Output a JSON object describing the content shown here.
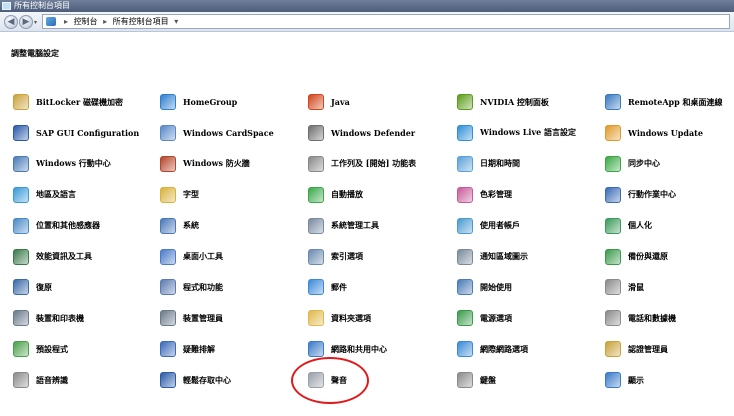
{
  "window": {
    "title": "所有控制台項目"
  },
  "nav": {
    "back_glyph": "◀",
    "forward_glyph": "▶",
    "dropdown_glyph": "▾",
    "breadcrumb": [
      "控制台",
      "所有控制台項目"
    ],
    "separator": "▸",
    "trailing_dropdown": "▾"
  },
  "main": {
    "heading": "調整電腦設定"
  },
  "items": [
    {
      "label": "BitLocker 磁碟機加密",
      "icon": "bitlocker-icon",
      "color": "#c9a23a"
    },
    {
      "label": "HomeGroup",
      "icon": "homegroup-icon",
      "color": "#2f7fd0"
    },
    {
      "label": "Java",
      "icon": "java-icon",
      "color": "#d1451b"
    },
    {
      "label": "NVIDIA 控制面板",
      "icon": "nvidia-icon",
      "color": "#5c9d1c"
    },
    {
      "label": "RemoteApp 和桌面連線",
      "icon": "remoteapp-icon",
      "color": "#3a78c2"
    },
    {
      "label": "SAP GUI Configuration",
      "icon": "sap-icon",
      "color": "#2a5aa8"
    },
    {
      "label": "Windows CardSpace",
      "icon": "cardspace-icon",
      "color": "#5a88c8"
    },
    {
      "label": "Windows Defender",
      "icon": "defender-icon",
      "color": "#6e6e6e"
    },
    {
      "label": "Windows Live 語言設定",
      "icon": "windows-live-icon",
      "color": "#2f8fd8"
    },
    {
      "label": "Windows Update",
      "icon": "windows-update-icon",
      "color": "#e09a2a"
    },
    {
      "label": "Windows 行動中心",
      "icon": "mobility-center-icon",
      "color": "#4a7ab8"
    },
    {
      "label": "Windows 防火牆",
      "icon": "firewall-icon",
      "color": "#b5452a"
    },
    {
      "label": "工作列及 [開始] 功能表",
      "icon": "taskbar-icon",
      "color": "#888888"
    },
    {
      "label": "日期和時間",
      "icon": "date-time-icon",
      "color": "#5aa0d8"
    },
    {
      "label": "同步中心",
      "icon": "sync-center-icon",
      "color": "#3aa844"
    },
    {
      "label": "地區及語言",
      "icon": "region-language-icon",
      "color": "#3a9ad8"
    },
    {
      "label": "字型",
      "icon": "fonts-icon",
      "color": "#d8b23a"
    },
    {
      "label": "自動播放",
      "icon": "autoplay-icon",
      "color": "#3aa84a"
    },
    {
      "label": "色彩管理",
      "icon": "color-management-icon",
      "color": "#c85a9a"
    },
    {
      "label": "行動作業中心",
      "icon": "action-center-icon",
      "color": "#3a6ab8"
    },
    {
      "label": "位置和其他感應器",
      "icon": "location-sensors-icon",
      "color": "#4a8ac8"
    },
    {
      "label": "系統",
      "icon": "system-icon",
      "color": "#4a78b8"
    },
    {
      "label": "系統管理工具",
      "icon": "admin-tools-icon",
      "color": "#7a8aa0"
    },
    {
      "label": "使用者帳戶",
      "icon": "user-accounts-icon",
      "color": "#4a9ad0"
    },
    {
      "label": "個人化",
      "icon": "personalization-icon",
      "color": "#3a9a5a"
    },
    {
      "label": "效能資訊及工具",
      "icon": "performance-icon",
      "color": "#3a7a4a"
    },
    {
      "label": "桌面小工具",
      "icon": "gadgets-icon",
      "color": "#4a7ac8"
    },
    {
      "label": "索引選項",
      "icon": "indexing-icon",
      "color": "#6a8ab0"
    },
    {
      "label": "通知區域圖示",
      "icon": "notification-area-icon",
      "color": "#7a8a9a"
    },
    {
      "label": "備份與還原",
      "icon": "backup-restore-icon",
      "color": "#3a9a4a"
    },
    {
      "label": "復原",
      "icon": "recovery-icon",
      "color": "#3a6aa8"
    },
    {
      "label": "程式和功能",
      "icon": "programs-features-icon",
      "color": "#5a7ab0"
    },
    {
      "label": "郵件",
      "icon": "mail-icon",
      "color": "#3a8ad8"
    },
    {
      "label": "開始使用",
      "icon": "getting-started-icon",
      "color": "#4a7ab8"
    },
    {
      "label": "滑鼠",
      "icon": "mouse-icon",
      "color": "#8a8a8a"
    },
    {
      "label": "裝置和印表機",
      "icon": "devices-printers-icon",
      "color": "#6a7a8a"
    },
    {
      "label": "裝置管理員",
      "icon": "device-manager-icon",
      "color": "#6a7a8a"
    },
    {
      "label": "資料夾選項",
      "icon": "folder-options-icon",
      "color": "#e0b84a"
    },
    {
      "label": "電源選項",
      "icon": "power-options-icon",
      "color": "#3a9a4a"
    },
    {
      "label": "電話和數據機",
      "icon": "phone-modem-icon",
      "color": "#8a8a8a"
    },
    {
      "label": "預設程式",
      "icon": "default-programs-icon",
      "color": "#4aa04a"
    },
    {
      "label": "疑難排解",
      "icon": "troubleshooting-icon",
      "color": "#3a6ab8"
    },
    {
      "label": "網路和共用中心",
      "icon": "network-sharing-icon",
      "color": "#3a7ac8"
    },
    {
      "label": "網際網路選項",
      "icon": "internet-options-icon",
      "color": "#3a8ad8"
    },
    {
      "label": "認證管理員",
      "icon": "credential-manager-icon",
      "color": "#c8a23a"
    },
    {
      "label": "語音辨識",
      "icon": "speech-recognition-icon",
      "color": "#8a8a8a"
    },
    {
      "label": "輕鬆存取中心",
      "icon": "ease-of-access-icon",
      "color": "#2a5aa8"
    },
    {
      "label": "聲音",
      "icon": "sound-icon",
      "color": "#9aa0a8"
    },
    {
      "label": "鍵盤",
      "icon": "keyboard-icon",
      "color": "#8a8a8a"
    },
    {
      "label": "顯示",
      "icon": "display-icon",
      "color": "#3a7ac8"
    }
  ],
  "annotation": {
    "color": "#e01a1a",
    "target": "sound-icon"
  }
}
